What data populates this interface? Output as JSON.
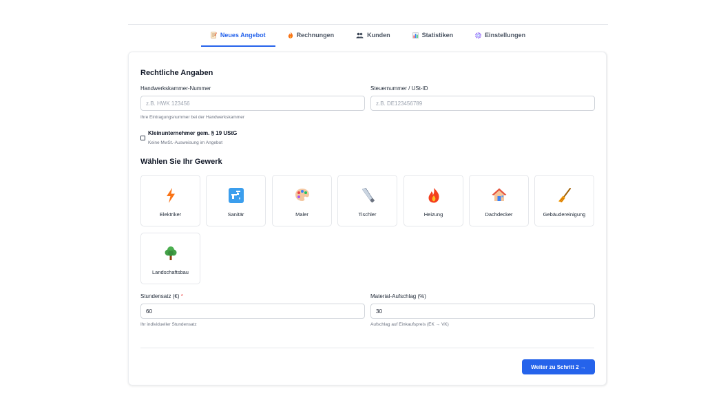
{
  "nav": {
    "tabs": [
      {
        "label": "Neues Angebot",
        "icon": "memo-icon",
        "active": true
      },
      {
        "label": "Rechnungen",
        "icon": "fire-icon",
        "active": false
      },
      {
        "label": "Kunden",
        "icon": "people-icon",
        "active": false
      },
      {
        "label": "Statistiken",
        "icon": "bar-chart-icon",
        "active": false
      },
      {
        "label": "Einstellungen",
        "icon": "gear-icon",
        "active": false
      }
    ]
  },
  "legal": {
    "title": "Rechtliche Angaben",
    "hwk": {
      "label": "Handwerkskammer-Nummer",
      "placeholder": "z.B. HWK 123456",
      "value": "",
      "hint": "Ihre Eintragungsnummer bei der Handwerkskammer"
    },
    "tax": {
      "label": "Steuernummer / USt-ID",
      "placeholder": "z.B. DE123456789",
      "value": ""
    },
    "small_business": {
      "label": "Kleinunternehmer gem. § 19 UStG",
      "hint": "Keine MwSt.-Ausweisung im Angebot",
      "checked": false
    }
  },
  "trade": {
    "title": "Wählen Sie Ihr Gewerk",
    "items": [
      {
        "label": "Elektriker",
        "icon": "lightning-icon"
      },
      {
        "label": "Sanitär",
        "icon": "faucet-icon"
      },
      {
        "label": "Maler",
        "icon": "palette-icon"
      },
      {
        "label": "Tischler",
        "icon": "saw-icon"
      },
      {
        "label": "Heizung",
        "icon": "flame-icon"
      },
      {
        "label": "Dachdecker",
        "icon": "house-icon"
      },
      {
        "label": "Gebäudereinigung",
        "icon": "broom-icon"
      },
      {
        "label": "Landschaftsbau",
        "icon": "tree-icon"
      }
    ]
  },
  "rates": {
    "hourly": {
      "label": "Stundensatz (€)",
      "required_mark": "*",
      "value": "60",
      "hint": "Ihr individueller Stundensatz"
    },
    "markup": {
      "label": "Material-Aufschlag (%)",
      "value": "30",
      "hint": "Aufschlag auf Einkaufspreis (EK → VK)"
    }
  },
  "actions": {
    "next_label": "Weiter zu Schritt 2 →"
  },
  "colors": {
    "accent": "#2563eb",
    "required": "#ef4444"
  }
}
